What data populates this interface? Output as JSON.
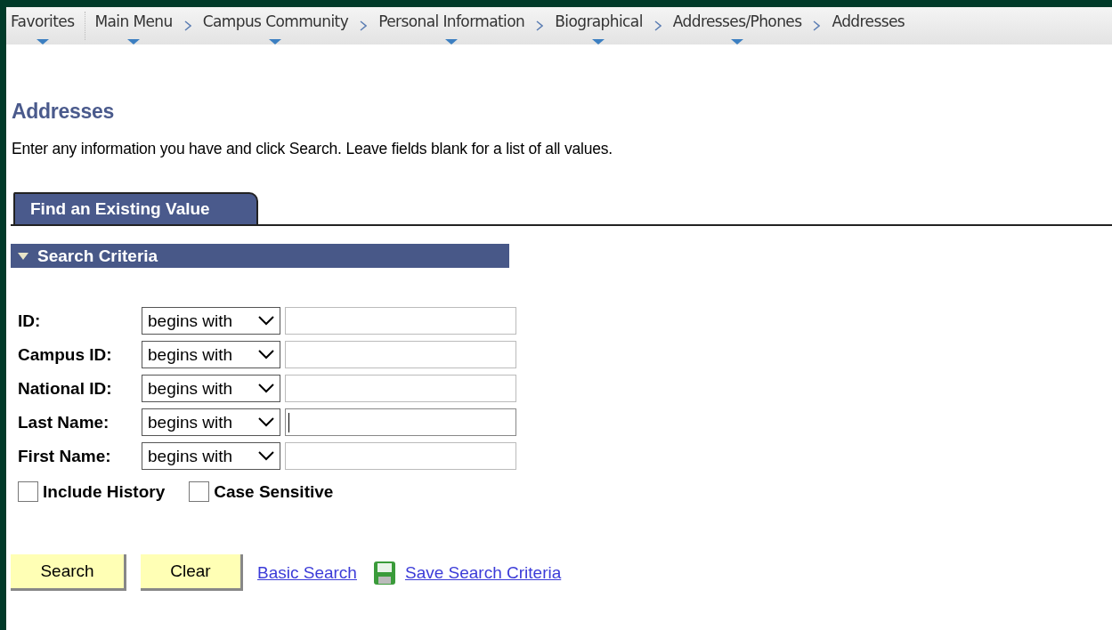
{
  "breadcrumbs": [
    {
      "label": "Favorites",
      "has_menu": true
    },
    {
      "label": "Main Menu",
      "has_menu": true
    },
    {
      "label": "Campus Community",
      "has_menu": true
    },
    {
      "label": "Personal Information",
      "has_menu": true
    },
    {
      "label": "Biographical",
      "has_menu": true
    },
    {
      "label": "Addresses/Phones",
      "has_menu": true
    },
    {
      "label": "Addresses",
      "has_menu": false
    }
  ],
  "page_title": "Addresses",
  "instructions": "Enter any information you have and click Search. Leave fields blank for a list of all values.",
  "tabs": [
    {
      "label": "Find an Existing Value",
      "selected": true
    }
  ],
  "section": {
    "title": "Search Criteria",
    "expanded": true
  },
  "fields": [
    {
      "label": "ID:",
      "operator": "begins with",
      "focused": false
    },
    {
      "label": "Campus ID:",
      "operator": "begins with",
      "focused": false
    },
    {
      "label": "National ID:",
      "operator": "begins with",
      "focused": false
    },
    {
      "label": "Last Name:",
      "operator": "begins with",
      "focused": true
    },
    {
      "label": "First Name:",
      "operator": "begins with",
      "focused": false
    }
  ],
  "options": [
    {
      "label": "Include History",
      "checked": false
    },
    {
      "label": "Case Sensitive",
      "checked": false
    }
  ],
  "buttons": [
    "Search",
    "Clear"
  ],
  "links": [
    {
      "label": "Basic Search",
      "kind": "plain"
    },
    {
      "label": "Save Search Criteria",
      "kind": "save"
    }
  ]
}
